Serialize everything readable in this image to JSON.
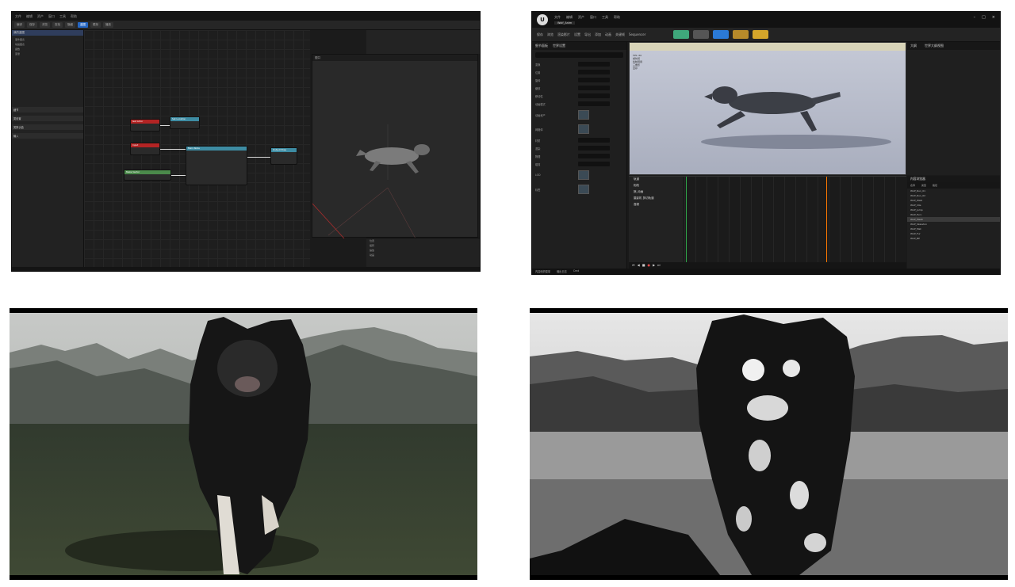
{
  "colors": {
    "ue_bg": "#1b1b1b",
    "accent_blue": "#2566c2",
    "node_red": "#b32424",
    "node_teal": "#3e8ca3",
    "node_green": "#4b8a4b",
    "playhead": "#ff7a00",
    "sky": "#c9cccd",
    "ground": "#39442f"
  },
  "panel1": {
    "menu": [
      "文件",
      "编辑",
      "资产",
      "窗口",
      "工具",
      "帮助"
    ],
    "toolbar": [
      "编译",
      "保存",
      "浏览",
      "查找",
      "隐藏",
      "蓝图",
      "模拟",
      "播放"
    ],
    "left_header": "我的蓝图",
    "left_rows": [
      "事件图表",
      "动画图表",
      "函数",
      "变量"
    ],
    "left_sections": [
      "细节",
      "类设置",
      "类默认值",
      "输入"
    ],
    "preview_title": "视口",
    "node_titles": [
      "Get Actor",
      "Set Location",
      "Main Node",
      "Output Pose",
      "Input",
      "Make Vector"
    ],
    "details_rows": [
      "位置",
      "旋转",
      "缩放",
      "动画"
    ],
    "icons": [
      "blueprint-node-icon",
      "wolf-model-icon"
    ]
  },
  "panel2": {
    "tab_name": "Wolf_Anim",
    "menu": [
      "文件",
      "编辑",
      "资产",
      "窗口",
      "工具",
      "帮助"
    ],
    "toolbar": [
      "保存",
      "浏览",
      "渲染影片",
      "设置",
      "导出",
      "添加",
      "动画",
      "关键帧",
      "Sequencer"
    ],
    "left_tabs": [
      "细节面板",
      "世界设置"
    ],
    "prop_labels": [
      "变换",
      "位置",
      "旋转",
      "缩放",
      "移动性",
      "动画模式",
      "动画资产",
      "网格体",
      "材质",
      "渲染",
      "物理",
      "碰撞",
      "LOD",
      "标签"
    ],
    "vp_stats": [
      "FPS: 60",
      "帧时间",
      "绘制调用",
      "三角形",
      "显存"
    ],
    "outliner_tabs": [
      "大纲",
      "世界大纲视图"
    ],
    "tracks": [
      "轨道",
      "相机",
      "狼_动画",
      "摄影机 剪切轨道",
      "音频"
    ],
    "content_header": "内容浏览器",
    "content_cols": [
      "名称",
      "类型",
      "路径"
    ],
    "content_rows": [
      "Wolf_Run_01",
      "Wolf_Run_02",
      "Wolf_Walk",
      "Wolf_Idle",
      "Wolf_Jump",
      "Wolf_Turn",
      "Wolf_Mesh",
      "Wolf_Skeleton",
      "Wolf_Mat",
      "Wolf_Fur",
      "Wolf_BP"
    ],
    "transport": [
      "⏮",
      "◀",
      "■",
      "●",
      "▶",
      "⏭"
    ],
    "statusbar": [
      "内容侧滑菜单",
      "输出日志",
      "Cmd"
    ]
  }
}
